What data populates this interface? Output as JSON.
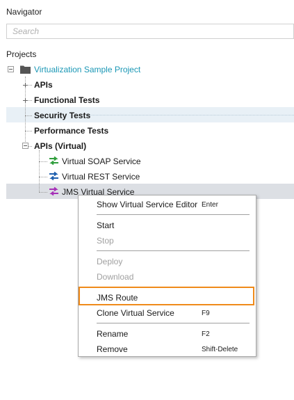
{
  "panel": {
    "title": "Navigator",
    "search_placeholder": "Search",
    "projects_label": "Projects"
  },
  "tree": {
    "project": "Virtualization Sample Project",
    "items": [
      {
        "label": "APIs"
      },
      {
        "label": "Functional Tests"
      },
      {
        "label": "Security Tests"
      },
      {
        "label": "Performance Tests"
      },
      {
        "label": "APIs (Virtual)"
      }
    ],
    "virtual_services": [
      {
        "label": "Virtual SOAP Service"
      },
      {
        "label": "Virtual REST Service"
      },
      {
        "label": "JMS Virtual Service"
      }
    ]
  },
  "context_menu": {
    "items": [
      {
        "label": "Show Virtual Service Editor",
        "shortcut": "Enter",
        "enabled": true
      },
      {
        "label": "Start",
        "shortcut": "",
        "enabled": true
      },
      {
        "label": "Stop",
        "shortcut": "",
        "enabled": false
      },
      {
        "label": "Deploy",
        "shortcut": "",
        "enabled": false
      },
      {
        "label": "Download",
        "shortcut": "",
        "enabled": false
      },
      {
        "label": "JMS Route",
        "shortcut": "",
        "enabled": true,
        "highlighted": true
      },
      {
        "label": "Clone Virtual Service",
        "shortcut": "F9",
        "enabled": true
      },
      {
        "label": "Rename",
        "shortcut": "F2",
        "enabled": true
      },
      {
        "label": "Remove",
        "shortcut": "Shift-Delete",
        "enabled": true
      }
    ]
  },
  "colors": {
    "project_link": "#1a97b5",
    "soap_icon": "#2f9e3c",
    "rest_icon": "#1f5fae",
    "jms_icon": "#a630b8",
    "highlight_border": "#ef8a1a"
  },
  "icons": {
    "project": "folder-icon",
    "soap": "virtual-soap-icon",
    "rest": "virtual-rest-icon",
    "jms": "virtual-jms-icon"
  }
}
